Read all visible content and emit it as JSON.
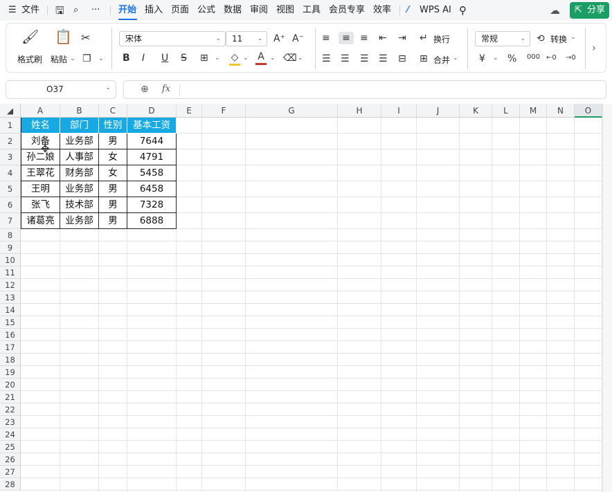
{
  "menubar": {
    "file_label": "文件",
    "tabs": [
      "开始",
      "插入",
      "页面",
      "公式",
      "数据",
      "审阅",
      "视图",
      "工具",
      "会员专享",
      "效率"
    ],
    "wps_ai_label": "WPS AI",
    "share_label": "分享"
  },
  "ribbon": {
    "format_painter_label": "格式刷",
    "paste_label": "粘贴",
    "font_name": "宋体",
    "font_size": "11",
    "wrap_label": "换行",
    "merge_label": "合并",
    "number_format": "常规",
    "convert_label": "转换",
    "bold": "B",
    "italic": "I",
    "underline": "U",
    "strike": "S",
    "percent": "%",
    "yen": "¥"
  },
  "formula_bar": {
    "name_box": "O37",
    "fx_label": "fx",
    "formula": ""
  },
  "sheet": {
    "columns": [
      "A",
      "B",
      "C",
      "D",
      "E",
      "F",
      "G",
      "H",
      "I",
      "J",
      "K",
      "L",
      "M",
      "N",
      "O"
    ],
    "rows": [
      "1",
      "2",
      "3",
      "4",
      "5",
      "6",
      "7",
      "8",
      "9",
      "10",
      "11",
      "12",
      "13",
      "14",
      "15",
      "16",
      "17",
      "18",
      "19",
      "20",
      "21",
      "22",
      "23",
      "24",
      "25",
      "26",
      "27",
      "28"
    ],
    "header": [
      "姓名",
      "部门",
      "性别",
      "基本工资"
    ],
    "data": [
      [
        "刘备",
        "业务部",
        "男",
        "7644"
      ],
      [
        "孙二娘",
        "人事部",
        "女",
        "4791"
      ],
      [
        "王翠花",
        "财务部",
        "女",
        "5458"
      ],
      [
        "王明",
        "业务部",
        "男",
        "6458"
      ],
      [
        "张飞",
        "技术部",
        "男",
        "7328"
      ],
      [
        "诸葛亮",
        "业务部",
        "男",
        "6888"
      ]
    ]
  },
  "colors": {
    "accent": "#1a73e8",
    "header_fill": "#17a9e3",
    "share_button": "#1a9e63"
  }
}
